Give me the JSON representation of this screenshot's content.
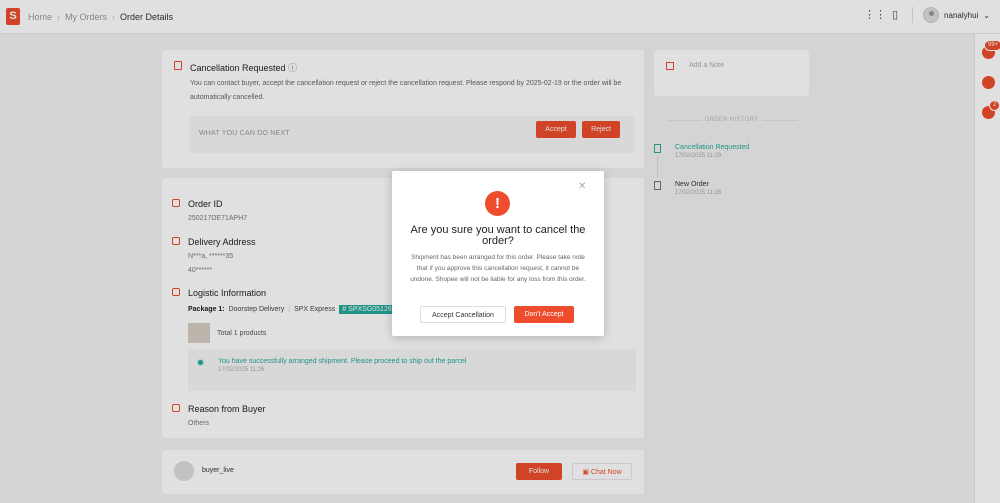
{
  "header": {
    "logo_text": "S",
    "breadcrumbs": [
      "Home",
      "My Orders",
      "Order Details"
    ],
    "username": "nanalyhui"
  },
  "rail": {
    "badge_top": "99+",
    "badge_chat": "2"
  },
  "cancellation": {
    "title": "Cancellation Requested",
    "text": "You can contact buyer, accept the cancellation request or reject the cancellation request. Please respond by 2025-02-19 or the order will be automatically cancelled.",
    "next_label": "WHAT YOU CAN DO NEXT",
    "accept_label": "Accept",
    "reject_label": "Reject"
  },
  "order": {
    "id_title": "Order ID",
    "id_value": "250217DE71APH7",
    "address_title": "Delivery Address",
    "address_name": "N***a, ******35",
    "address_line": "40******",
    "logistic_title": "Logistic Information",
    "package_label": "Package 1:",
    "delivery_type": "Doorstep Delivery",
    "courier": "SPX Express",
    "tracking": "# SPXSG05126",
    "products": "Total 1 products",
    "shipment_msg": "You have successfully arranged shipment. Please proceed to ship out the parcel",
    "shipment_date": "17/02/2025 11:26",
    "reason_title": "Reason from Buyer",
    "reason_value": "Others"
  },
  "buyer": {
    "name": "buyer_live",
    "follow_label": "Follow",
    "chat_label": "Chat Now"
  },
  "side": {
    "note_placeholder": "Add a Note",
    "history_title": "ORDER HISTORY",
    "history": [
      {
        "name": "Cancellation Requested",
        "date": "17/02/2025 11:29"
      },
      {
        "name": "New Order",
        "date": "17/02/2025 11:26"
      }
    ]
  },
  "modal": {
    "title": "Are you sure you want to cancel the order?",
    "body": "Shipment has been arranged for this order. Please take note that if you approve this cancellation request, it cannot be undone. Shopee will not be liable for any loss from this order.",
    "accept_label": "Accept Cancellation",
    "decline_label": "Don't Accept"
  },
  "colors": {
    "brand": "#ee4d2d",
    "success": "#26aa99"
  }
}
